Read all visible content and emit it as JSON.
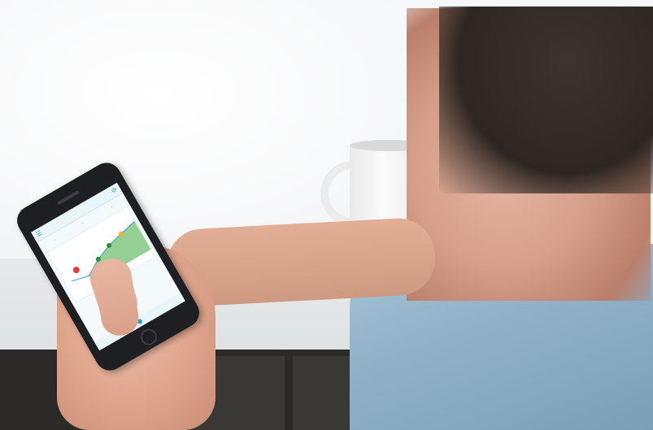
{
  "scene": {
    "subject": "man-holding-smartphone",
    "background_color": "#f3f4f5"
  },
  "phone_app": {
    "header": "",
    "subtitle": "",
    "stats": [],
    "accent_color": "#2a9fd6",
    "icons": [
      "menu-icon",
      "refresh-icon"
    ]
  }
}
